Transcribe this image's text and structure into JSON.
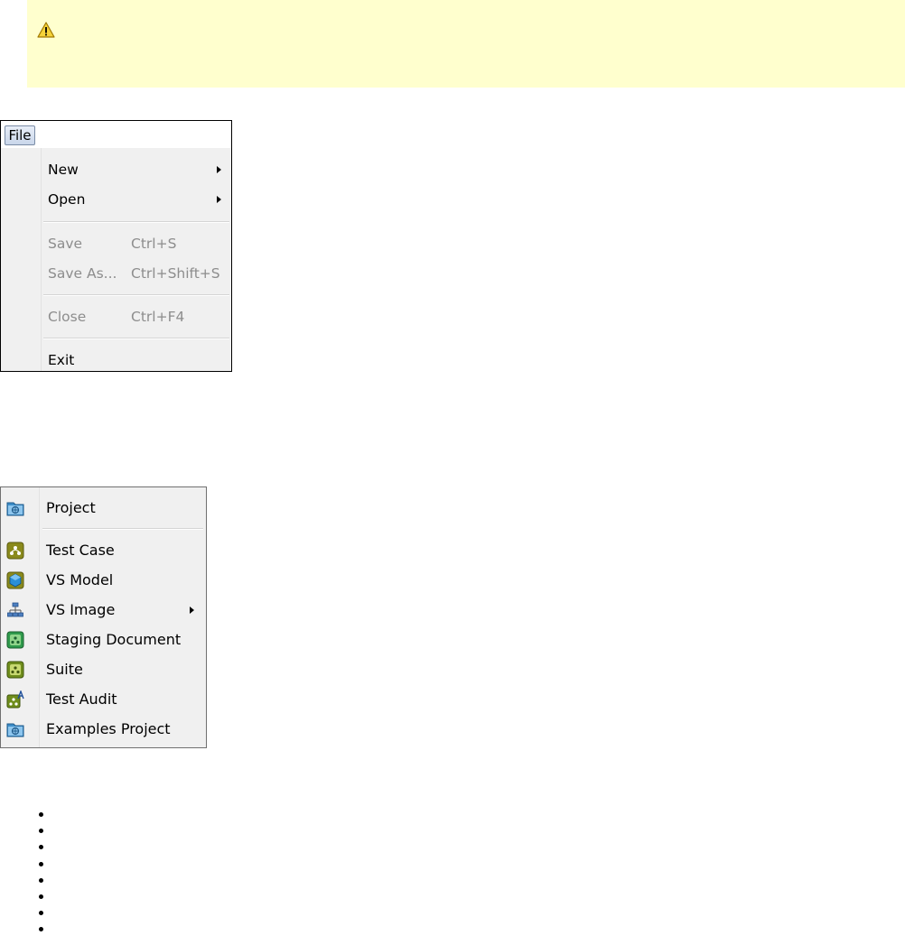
{
  "banner": {
    "icon": "warning-icon",
    "background": "#ffffce"
  },
  "file_menu": {
    "menubar_label": "File",
    "items": [
      {
        "label": "New",
        "submenu": true,
        "enabled": true
      },
      {
        "label": "Open",
        "submenu": true,
        "enabled": true
      },
      {
        "label": "Save",
        "shortcut": "Ctrl+S",
        "enabled": false
      },
      {
        "label": "Save As...",
        "shortcut": "Ctrl+Shift+S",
        "enabled": false
      },
      {
        "label": "Close",
        "shortcut": "Ctrl+F4",
        "enabled": false
      },
      {
        "label": "Exit",
        "enabled": true
      }
    ]
  },
  "new_menu": {
    "items": [
      {
        "label": "Project",
        "icon": "project-folder-icon"
      },
      {
        "label": "Test Case",
        "icon": "test-case-icon"
      },
      {
        "label": "VS Model",
        "icon": "vs-model-icon"
      },
      {
        "label": "VS Image",
        "icon": "vs-image-icon",
        "submenu": true
      },
      {
        "label": "Staging Document",
        "icon": "staging-document-icon"
      },
      {
        "label": "Suite",
        "icon": "suite-icon"
      },
      {
        "label": "Test Audit",
        "icon": "test-audit-icon"
      },
      {
        "label": "Examples Project",
        "icon": "examples-project-icon"
      }
    ]
  }
}
